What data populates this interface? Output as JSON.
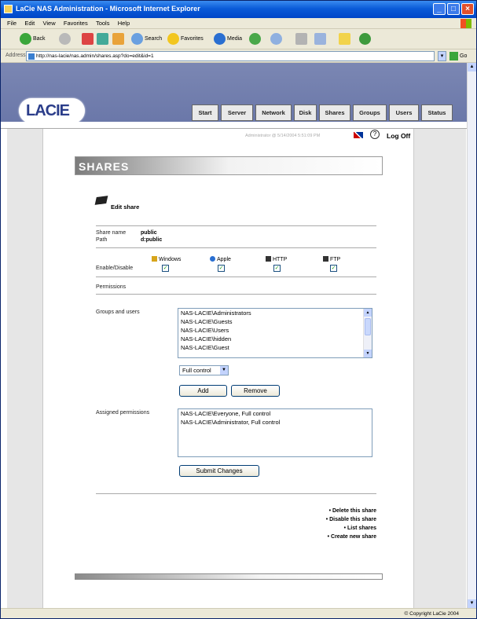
{
  "window": {
    "title": "LaCie NAS Administration - Microsoft Internet Explorer",
    "controls": [
      "minimize-icon",
      "maximize-icon",
      "close-icon"
    ]
  },
  "menu": [
    "File",
    "Edit",
    "View",
    "Favorites",
    "Tools",
    "Help"
  ],
  "toolbar": {
    "back": "Back",
    "search": "Search",
    "favorites": "Favorites",
    "media": "Media"
  },
  "address": {
    "label": "Address",
    "url": "http://nas-lacie/nas.admin/shares.asp?do=edit&id=1",
    "go": "Go"
  },
  "logo": "LACIE",
  "tabs": [
    "Start",
    "Server",
    "Network",
    "Disk",
    "Shares",
    "Groups",
    "Users",
    "Status"
  ],
  "userline": {
    "text": "Administrator @ 5/14/2004 5:51:09 PM",
    "logoff": "Log Off",
    "help_glyph": "?"
  },
  "page": {
    "title": "SHARES",
    "edit_title": "Edit share"
  },
  "share": {
    "name_label": "Share name",
    "name": "public",
    "path_label": "Path",
    "path": "d:public"
  },
  "services": {
    "enable_label": "Enable/Disable",
    "items": [
      {
        "label": "Windows",
        "icon": "windows-icon",
        "checked": true,
        "color": "#d7a51c"
      },
      {
        "label": "Apple",
        "icon": "apple-icon",
        "checked": true,
        "color": "#2a6fd1"
      },
      {
        "label": "HTTP",
        "icon": "http-icon",
        "checked": true,
        "color": "#333333"
      },
      {
        "label": "FTP",
        "icon": "ftp-icon",
        "checked": true,
        "color": "#333333"
      }
    ]
  },
  "permissions": {
    "label": "Permissions",
    "groups_label": "Groups and users",
    "groups": [
      "NAS-LACIE\\Administrators",
      "NAS-LACIE\\Guests",
      "NAS-LACIE\\Users",
      "NAS-LACIE\\hidden",
      "NAS-LACIE\\Guest"
    ],
    "access_level": "Full control",
    "add": "Add",
    "remove": "Remove",
    "assigned_label": "Assigned permissions",
    "assigned": [
      "NAS-LACIE\\Everyone, Full control",
      "NAS-LACIE\\Administrator, Full control"
    ],
    "submit": "Submit Changes"
  },
  "links": [
    "• Delete this share",
    "• Disable this share",
    "• List shares",
    "• Create new share"
  ],
  "copyright": "© Copyright LaCie 2004",
  "colors": {
    "header": "#6f7caa",
    "titlebar": "#0a5bd8",
    "check": "#21a121"
  }
}
